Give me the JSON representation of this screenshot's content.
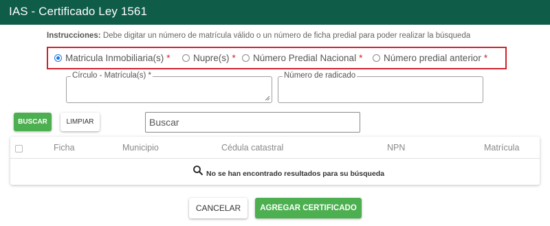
{
  "header": {
    "title": "IAS - Certificado Ley 1561"
  },
  "instructions": {
    "label": "Instrucciones:",
    "text": "Debe digitar un número de matrícula válido o un número de ficha predial para poder realizar la búsqueda"
  },
  "search_type": {
    "selected": "Matricula Inmobiliaria(s)",
    "options": [
      {
        "label": "Matricula Inmobiliaria(s)",
        "required": "*"
      },
      {
        "label": "Nupre(s)",
        "required": "*"
      },
      {
        "label": "Número Predial Nacional",
        "required": "*"
      },
      {
        "label": "Número predial anterior",
        "required": "*"
      }
    ]
  },
  "fields": {
    "circulo_matricula": {
      "label": "Círculo - Matrícula(s) *",
      "value": ""
    },
    "numero_radicado": {
      "label": "Número de radicado",
      "value": ""
    }
  },
  "actions": {
    "search_label": "BUSCAR",
    "clear_label": "LIMPIAR"
  },
  "search": {
    "placeholder": "Buscar",
    "value": ""
  },
  "table": {
    "columns": [
      "Ficha",
      "Municipio",
      "Cédula catastral",
      "NPN",
      "Matrícula"
    ],
    "rows": [],
    "empty_message": "No se han encontrado resultados para su búsqueda"
  },
  "footer": {
    "cancel_label": "CANCELAR",
    "add_label": "AGREGAR CERTIFICADO"
  },
  "colors": {
    "header_bg": "#0f5c48",
    "primary_green": "#4caf50",
    "highlight_red": "#d11f2a",
    "radio_selected": "#1a73e8"
  },
  "icons": {
    "empty_search": "search-icon",
    "textarea_resize": "resize-grip-icon"
  }
}
